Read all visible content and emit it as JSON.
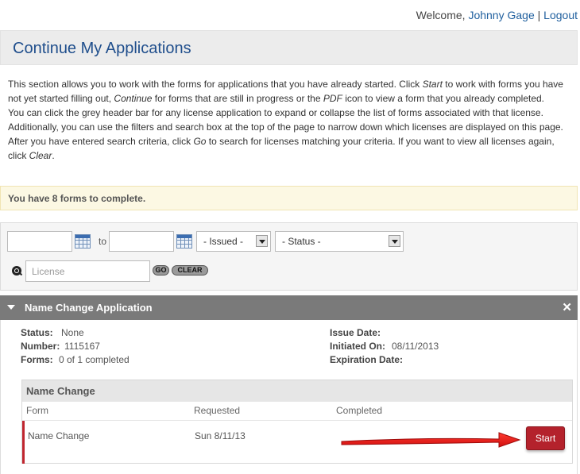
{
  "header": {
    "welcome_text": "Welcome,",
    "user_name": "Johnny Gage",
    "separator": "|",
    "logout_label": "Logout"
  },
  "page": {
    "title": "Continue My Applications"
  },
  "intro": {
    "p1_a": "This section allows you to work with the forms for applications that you have already started. Click ",
    "p1_start": "Start",
    "p1_b": " to work with forms you have not yet started filling out, ",
    "p1_continue": "Continue",
    "p1_c": " for forms that are still in progress or the ",
    "p1_pdf": "PDF",
    "p1_d": " icon to view a form that you already completed.",
    "p2_a": "You can click the grey header bar for any license application to expand or collapse the list of forms associated with that license. Additionally, you can use the filters and search box at the top of the page to narrow down which licenses are displayed on this page. After you have entered search criteria, click ",
    "p2_go": "Go",
    "p2_b": " to search for licenses matching your criteria. If you want to view all licenses again, click ",
    "p2_clear": "Clear",
    "p2_c": "."
  },
  "notice": {
    "text": "You have 8 forms to complete."
  },
  "filters": {
    "from_date": "",
    "to_label": "to",
    "to_date": "",
    "issued_select": "- Issued -",
    "status_select": "- Status -",
    "license_placeholder": "License",
    "go_label": "GO",
    "clear_label": "CLEAR"
  },
  "application": {
    "title": "Name Change Application",
    "close_glyph": "✕",
    "status_label": "Status:",
    "status_value": "None",
    "number_label": "Number:",
    "number_value": "1115167",
    "forms_label": "Forms:",
    "forms_value": "0 of 1 completed",
    "issue_date_label": "Issue Date:",
    "issue_date_value": "",
    "initiated_label": "Initiated On:",
    "initiated_value": "08/11/2013",
    "expiration_label": "Expiration Date:",
    "expiration_value": ""
  },
  "forms_table": {
    "group_title": "Name Change",
    "columns": [
      "Form",
      "Requested",
      "Completed"
    ],
    "rows": [
      {
        "form": "Name Change",
        "requested": "Sun 8/11/13",
        "completed": "",
        "action": "Start"
      }
    ]
  },
  "colors": {
    "accent_red": "#b4222c",
    "title_blue": "#1f4e8c",
    "header_gray": "#7a7a7a",
    "notice_yellow": "#fcf8e3"
  },
  "icons": [
    "calendar-icon",
    "chevron-down-icon",
    "search-icon",
    "close-icon",
    "collapse-caret-icon",
    "annotation-arrow"
  ]
}
